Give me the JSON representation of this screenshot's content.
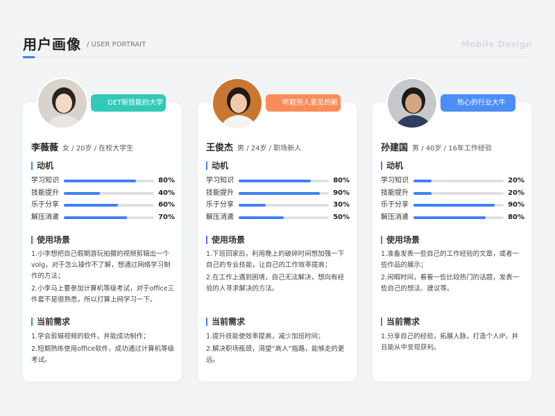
{
  "header": {
    "title": "用户画像",
    "subtitle": "/ USER PORTRAIT",
    "brand": "Mobile Design"
  },
  "colors": {
    "accent": "#3b82f6",
    "tag_teal": "#33c9b8",
    "tag_orange": "#fb8c5a",
    "tag_blue": "#4b8ef6"
  },
  "sections": {
    "motivation": "动机",
    "scenario": "使用场景",
    "needs": "当前需求"
  },
  "personas": [
    {
      "tag": "GET新技能的大学生",
      "name": "李薇薇",
      "meta": "女 / 20岁 / 在校大学生",
      "motivations": [
        {
          "label": "学习知识",
          "value": 80,
          "pct": "80%"
        },
        {
          "label": "技能提升",
          "value": 40,
          "pct": "40%"
        },
        {
          "label": "乐于分享",
          "value": 60,
          "pct": "60%"
        },
        {
          "label": "解压消遣",
          "value": 70,
          "pct": "70%"
        }
      ],
      "scenarios": [
        "1.小李想把自己假期游玩拍摄的视频剪辑出一个volg，对于怎么操作不了解，想通过网络学习制作的方法；",
        "2.小李马上要参加计算机等级考试，对于office三件套不是很熟悉，所以打算上网学习一下。"
      ],
      "needs": [
        "1.学会剪辑视频的软件，并能成功制作；",
        "2.短期熟练使用office软件，成功通过计算机等级考试。"
      ]
    },
    {
      "tag": "听取别人意见的新人",
      "name": "王俊杰",
      "meta": "男 / 24岁 / 职场新人",
      "motivations": [
        {
          "label": "学习知识",
          "value": 80,
          "pct": "80%"
        },
        {
          "label": "技能提升",
          "value": 90,
          "pct": "90%"
        },
        {
          "label": "乐于分享",
          "value": 30,
          "pct": "30%"
        },
        {
          "label": "解压消遣",
          "value": 50,
          "pct": "50%"
        }
      ],
      "scenarios": [
        "1.下班回家后，利用晚上的破碎时间想加强一下自己的专业技能，让自己的工作效率提高；",
        "2.在工作上遇到困境，自己无法解决，想向有经验的人寻求解决的方法。"
      ],
      "needs": [
        "1.提升技能使效率提高，减少加班时间；",
        "2.解决职场瓶颈，渴望“高人”指路，能够走的更远。"
      ]
    },
    {
      "tag": "热心的行业大牛",
      "name": "孙建国",
      "meta": "男 / 40岁 / 16年工作经验",
      "motivations": [
        {
          "label": "学习知识",
          "value": 20,
          "pct": "20%"
        },
        {
          "label": "技能提升",
          "value": 20,
          "pct": "20%"
        },
        {
          "label": "乐于分享",
          "value": 90,
          "pct": "90%"
        },
        {
          "label": "解压消遣",
          "value": 80,
          "pct": "80%"
        }
      ],
      "scenarios": [
        "1.准备发表一些自己的工作经验的文章，或者一些作品的展示；",
        "2.闲暇时间，看看一些比较热门的话题，发表一些自己的想法、建议等。"
      ],
      "needs": [
        "1.分享自己的经验，拓展人脉，打造个人IP，并且能从中变现获利。"
      ]
    }
  ]
}
